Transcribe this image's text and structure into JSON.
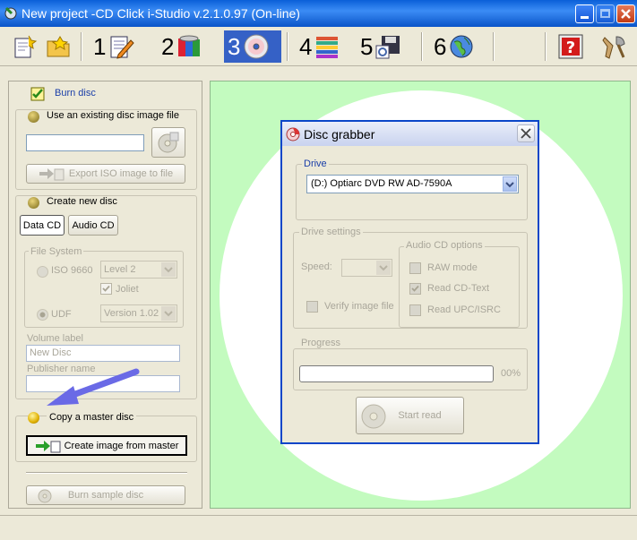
{
  "window": {
    "title": "New project -CD Click i-Studio v.2.1.0.97 (On-line)"
  },
  "toolbar": {
    "steps": [
      {
        "num": "1",
        "icon": "edit-icon"
      },
      {
        "num": "2",
        "icon": "files-icon"
      },
      {
        "num": "3",
        "icon": "disc-icon"
      },
      {
        "num": "4",
        "icon": "books-icon"
      },
      {
        "num": "5",
        "icon": "save-icon"
      },
      {
        "num": "6",
        "icon": "globe-icon"
      }
    ],
    "active_step": "3"
  },
  "left": {
    "burn_disc_label": "Burn disc",
    "existing_image": {
      "label": "Use an existing disc image file",
      "path_value": "",
      "export_label": "Export ISO image to file"
    },
    "new_disc": {
      "label": "Create new disc",
      "tab_data": "Data CD",
      "tab_audio": "Audio CD",
      "file_system_label": "File System",
      "iso_label": "ISO 9660",
      "iso_level": "Level 2",
      "joliet_label": "Joliet",
      "udf_label": "UDF",
      "udf_version": "Version 1.02",
      "volume_label": "Volume label",
      "volume_value": "New Disc",
      "publisher_label": "Publisher name",
      "publisher_value": ""
    },
    "copy_master": {
      "label": "Copy a master disc",
      "create_image_label": "Create image from master"
    },
    "burn_sample_label": "Burn sample disc"
  },
  "dialog": {
    "title": "Disc grabber",
    "drive_label": "Drive",
    "drive_value": "(D:) Optiarc  DVD RW AD-7590A",
    "drive_settings_label": "Drive settings",
    "speed_label": "Speed:",
    "speed_value": "",
    "verify_label": "Verify image file",
    "audio_options_label": "Audio CD options",
    "raw_mode_label": "RAW mode",
    "cd_text_label": "Read CD-Text",
    "upc_label": "Read UPC/ISRC",
    "progress_label": "Progress",
    "progress_percent": "00%",
    "progress_fraction": 0,
    "start_read_label": "Start read"
  }
}
